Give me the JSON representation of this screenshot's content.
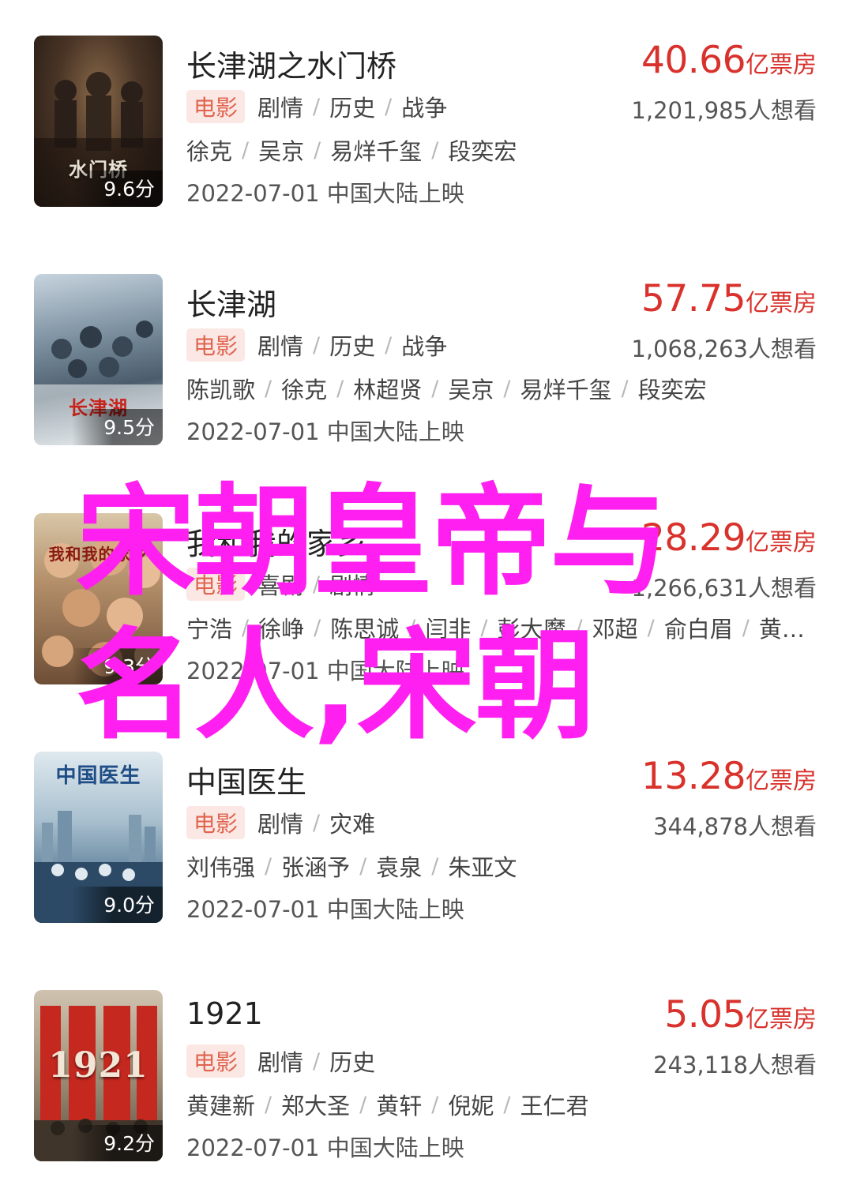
{
  "movies": [
    {
      "title": "长津湖之水门桥",
      "poster_text": "水门桥",
      "score": "9.6分",
      "gross_number": "40.66",
      "gross_unit": "亿票房",
      "tag": "电影",
      "genres": [
        "剧情",
        "历史",
        "战争"
      ],
      "want_count": "1,201,985人想看",
      "cast": [
        "徐克",
        "吴京",
        "易烊千玺",
        "段奕宏"
      ],
      "release": "2022-07-01 中国大陆上映"
    },
    {
      "title": "长津湖",
      "poster_text": "长津湖",
      "score": "9.5分",
      "gross_number": "57.75",
      "gross_unit": "亿票房",
      "tag": "电影",
      "genres": [
        "剧情",
        "历史",
        "战争"
      ],
      "want_count": "1,068,263人想看",
      "cast": [
        "陈凯歌",
        "徐克",
        "林超贤",
        "吴京",
        "易烊千玺",
        "段奕宏"
      ],
      "release": "2022-07-01 中国大陆上映"
    },
    {
      "title": "我和我的家乡",
      "poster_text": "我和我的家乡",
      "score": "9.3分",
      "gross_number": "28.29",
      "gross_unit": "亿票房",
      "tag": "电影",
      "genres": [
        "喜剧",
        "剧情"
      ],
      "want_count": "1,266,631人想看",
      "cast": [
        "宁浩",
        "徐峥",
        "陈思诚",
        "闫非",
        "彭大魔",
        "邓超",
        "俞白眉",
        "黄…"
      ],
      "release": "2022-07-01 中国大陆上映"
    },
    {
      "title": "中国医生",
      "poster_text": "中国医生",
      "score": "9.0分",
      "gross_number": "13.28",
      "gross_unit": "亿票房",
      "tag": "电影",
      "genres": [
        "剧情",
        "灾难"
      ],
      "want_count": "344,878人想看",
      "cast": [
        "刘伟强",
        "张涵予",
        "袁泉",
        "朱亚文"
      ],
      "release": "2022-07-01 中国大陆上映"
    },
    {
      "title": "1921",
      "poster_text": "1921",
      "score": "9.2分",
      "gross_number": "5.05",
      "gross_unit": "亿票房",
      "tag": "电影",
      "genres": [
        "剧情",
        "历史"
      ],
      "want_count": "243,118人想看",
      "cast": [
        "黄建新",
        "郑大圣",
        "黄轩",
        "倪妮",
        "王仁君"
      ],
      "release": "2022-07-01 中国大陆上映"
    }
  ],
  "overlay": {
    "line1": "宋朝皇帝与",
    "line2": "名人,宋朝"
  },
  "colors": {
    "accent_red": "#d9312b",
    "tag_bg": "#fbe7e3",
    "tag_text": "#e0644f",
    "overlay_magenta": "#ff1ff0"
  },
  "separator": "/"
}
